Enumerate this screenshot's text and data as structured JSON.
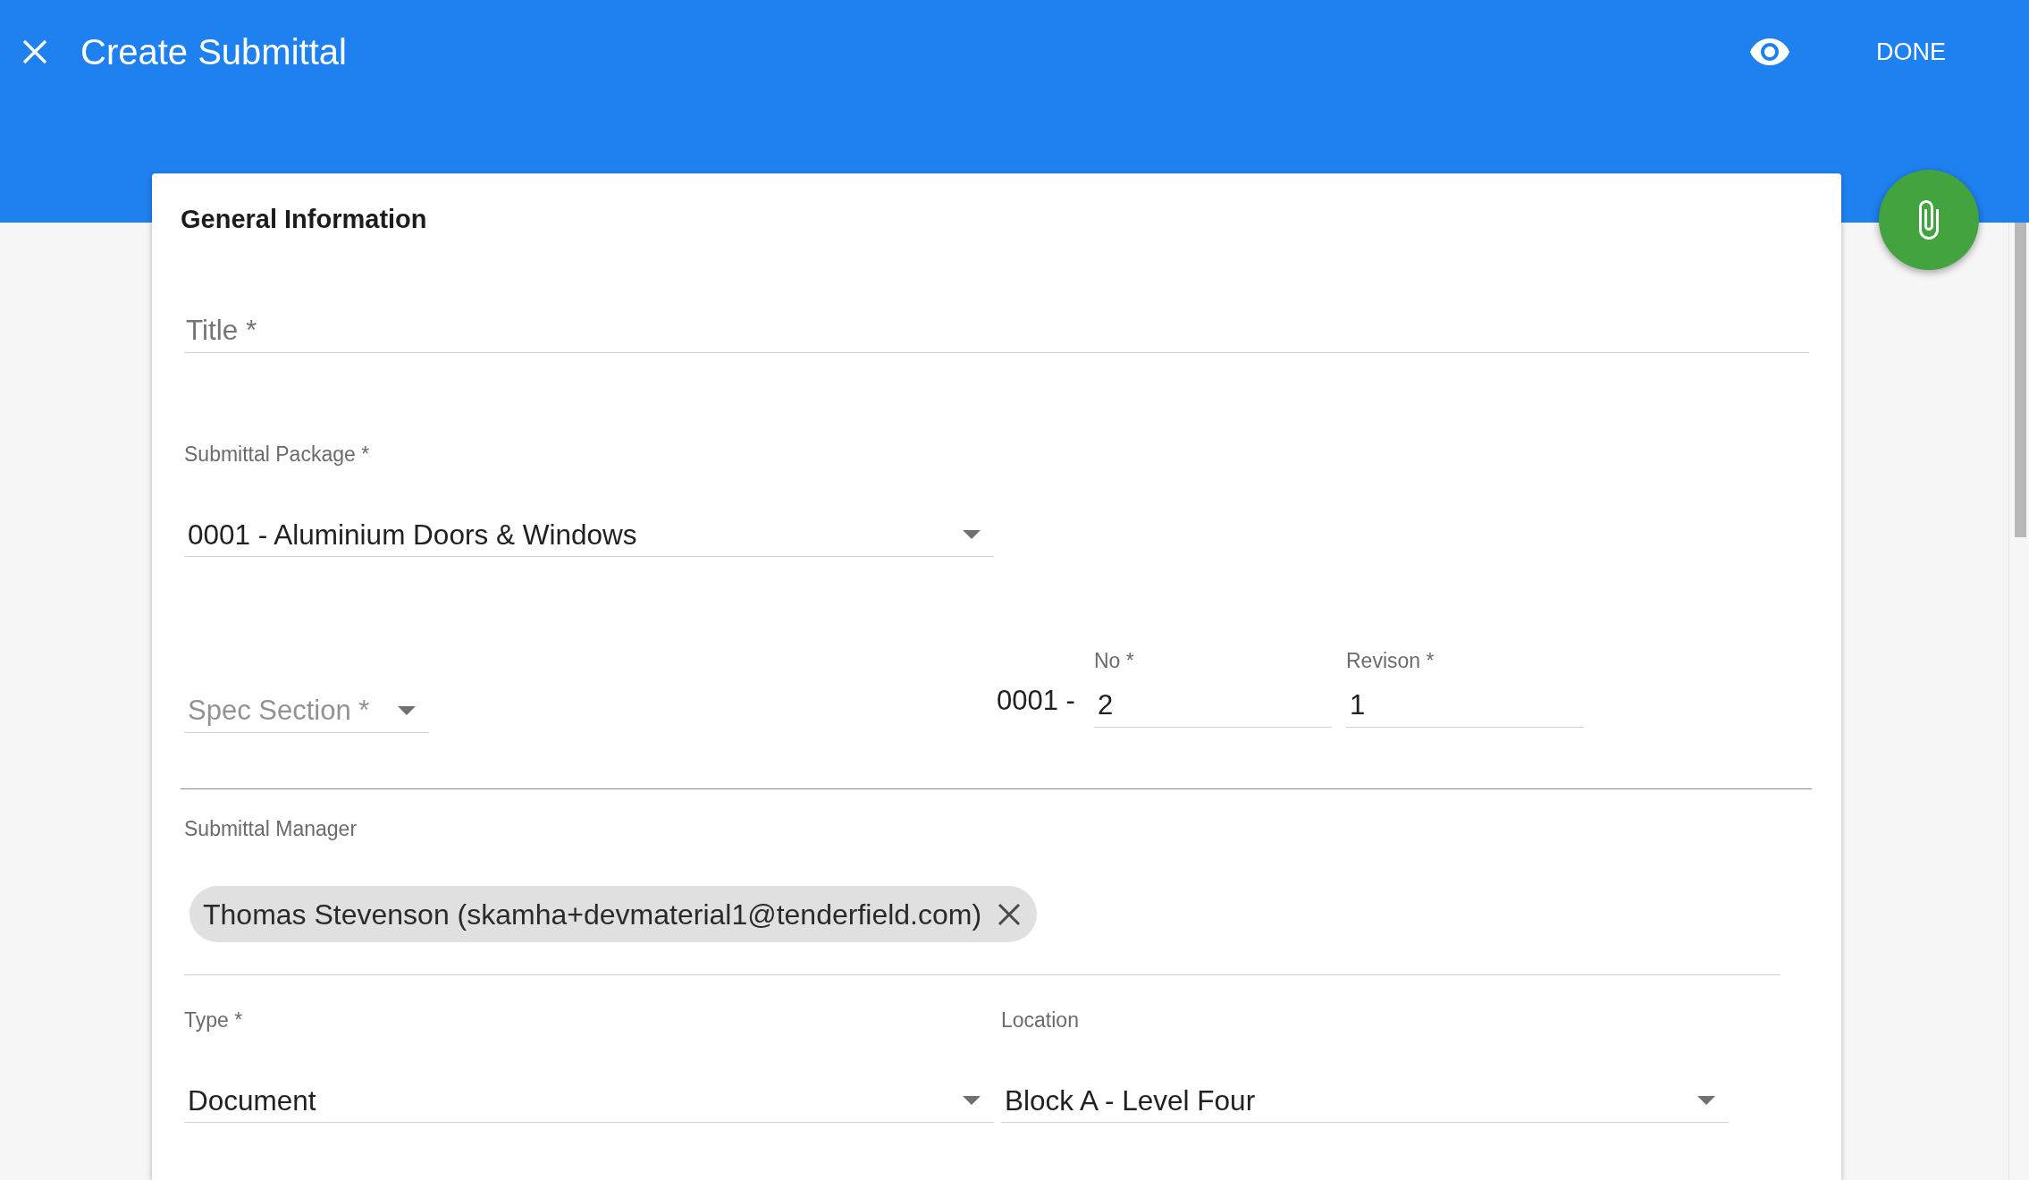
{
  "header": {
    "title": "Create Submittal",
    "done_button": "DONE"
  },
  "form": {
    "heading": "General Information",
    "title_field": {
      "placeholder": "Title *"
    },
    "submittal_package": {
      "label": "Submittal Package *",
      "value": "0001 - Aluminium Doors & Windows"
    },
    "spec_section": {
      "placeholder": "Spec Section *"
    },
    "number_prefix": "0001 -",
    "number": {
      "label": "No *",
      "value": "2"
    },
    "revision": {
      "label": "Revison *",
      "value": "1"
    },
    "submittal_manager": {
      "label": "Submittal Manager",
      "chips": [
        "Thomas Stevenson (skamha+devmaterial1@tenderfield.com)"
      ]
    },
    "type": {
      "label": "Type *",
      "value": "Document"
    },
    "location": {
      "label": "Location",
      "value": "Block A - Level Four"
    }
  }
}
